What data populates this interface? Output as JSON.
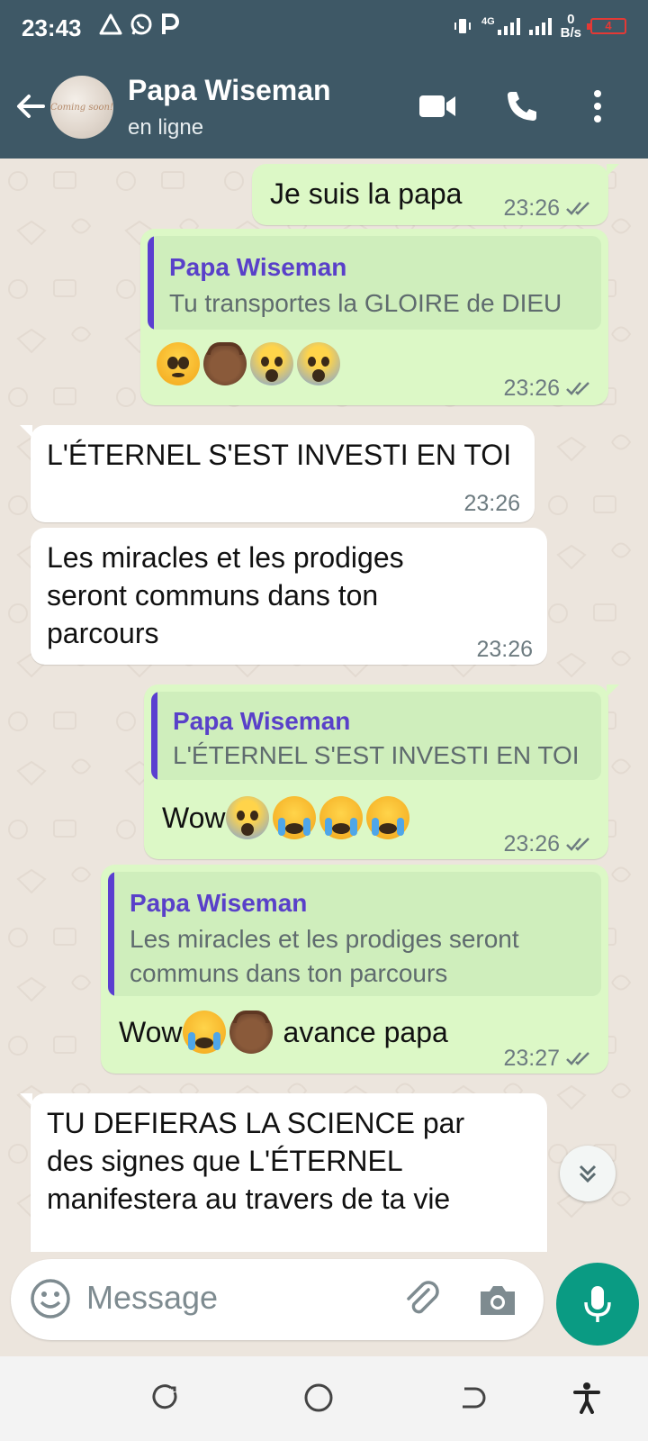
{
  "status_bar": {
    "time": "23:43",
    "notification_icons": [
      "alert-triangle-icon",
      "whatsapp-icon",
      "p-icon"
    ],
    "network_type": "4G",
    "net_speed_value": "0",
    "net_speed_unit": "B/s",
    "battery_level": "4"
  },
  "header": {
    "contact_name": "Papa Wiseman",
    "contact_status": "en ligne",
    "avatar_text": "Coming soon!"
  },
  "messages": [
    {
      "dir": "out",
      "text": "Je suis la papa",
      "time": "23:26"
    },
    {
      "dir": "out",
      "quote_author": "Papa Wiseman",
      "quote_text": "Tu transportes la GLOIRE de DIEU",
      "emojis": [
        "pleading-face",
        "person-gesturing-ok",
        "face-screaming",
        "face-screaming"
      ],
      "time": "23:26"
    },
    {
      "dir": "in",
      "text": "L'ÉTERNEL S'EST INVESTI EN TOI",
      "time": "23:26"
    },
    {
      "dir": "in",
      "text": "Les miracles et les prodiges seront communs dans ton parcours",
      "time": "23:26"
    },
    {
      "dir": "out",
      "quote_author": "Papa Wiseman",
      "quote_text": "L'ÉTERNEL S'EST INVESTI EN TOI",
      "text": "Wow",
      "emojis": [
        "face-screaming",
        "loudly-crying-face",
        "loudly-crying-face",
        "loudly-crying-face"
      ],
      "time": "23:26"
    },
    {
      "dir": "out",
      "quote_author": "Papa Wiseman",
      "quote_text": "Les miracles et les prodiges seront communs dans ton parcours",
      "text_before": "Wow",
      "emojis": [
        "loudly-crying-face",
        "person-gesturing-ok"
      ],
      "text_after": "avance papa",
      "time": "23:27"
    },
    {
      "dir": "in",
      "text": "TU DEFIERAS LA SCIENCE par des signes que L'ÉTERNEL manifestera au travers de ta vie"
    }
  ],
  "input": {
    "placeholder": "Message"
  },
  "colors": {
    "header_bg": "#3e5866",
    "outgoing_bubble": "#dcf8c6",
    "incoming_bubble": "#ffffff",
    "chat_bg": "#ece5dd",
    "quote_author": "#5940c9",
    "mic_button": "#0a9b83",
    "read_ticks": "#6d7b80"
  },
  "nav_icons": [
    "recent-apps-icon",
    "home-icon",
    "back-icon",
    "accessibility-icon"
  ]
}
